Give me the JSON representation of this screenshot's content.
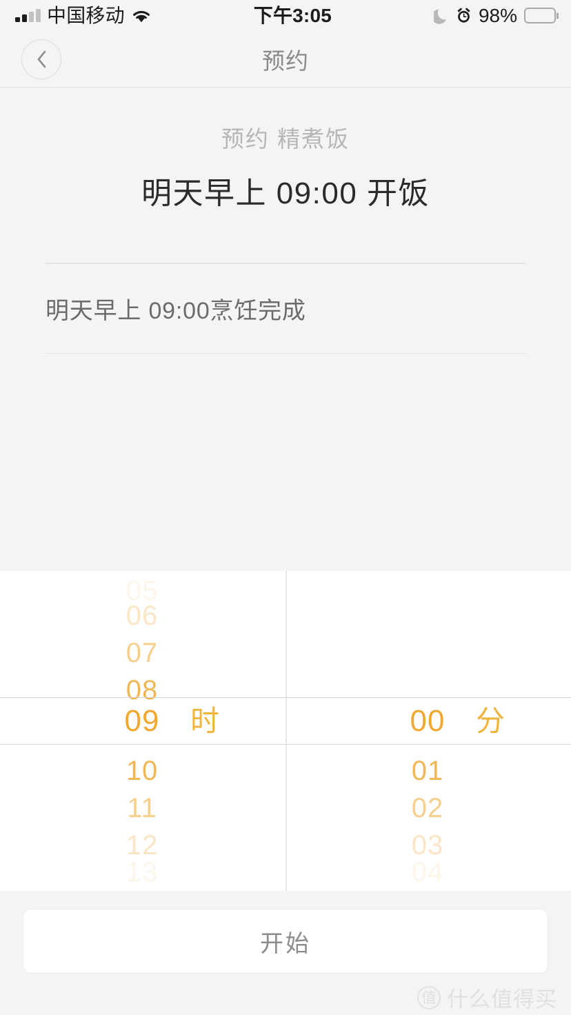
{
  "status_bar": {
    "carrier": "中国移动",
    "time": "下午3:05",
    "battery_percent": "98%",
    "signal_bars_filled": 2,
    "signal_bars_total": 4,
    "icons": [
      "signal-icon",
      "wifi-icon",
      "moon-icon",
      "alarm-icon",
      "battery-icon"
    ]
  },
  "nav": {
    "title": "预约",
    "back_icon": "chevron-left-icon"
  },
  "summary": {
    "subtitle": "预约 精煮饭",
    "headline": "明天早上 09:00 开饭",
    "detail": "明天早上 09:00烹饪完成"
  },
  "picker": {
    "hours": {
      "selected": "09",
      "unit": "时",
      "above": [
        "05",
        "06",
        "07",
        "08"
      ],
      "below": [
        "10",
        "11",
        "12",
        "13"
      ]
    },
    "minutes": {
      "selected": "00",
      "unit": "分",
      "above": [],
      "below": [
        "01",
        "02",
        "03",
        "04"
      ]
    }
  },
  "footer": {
    "start_label": "开始"
  },
  "watermark": {
    "badge": "值",
    "text": "什么值得买"
  },
  "colors": {
    "accent": "#f0a830",
    "accent_unit": "#eeb63e",
    "page_bg": "#f4f4f4",
    "panel_bg": "#ffffff",
    "title_text": "#2b2b2b",
    "muted_text": "#8a8a8d",
    "divider": "#e3e3e3"
  }
}
